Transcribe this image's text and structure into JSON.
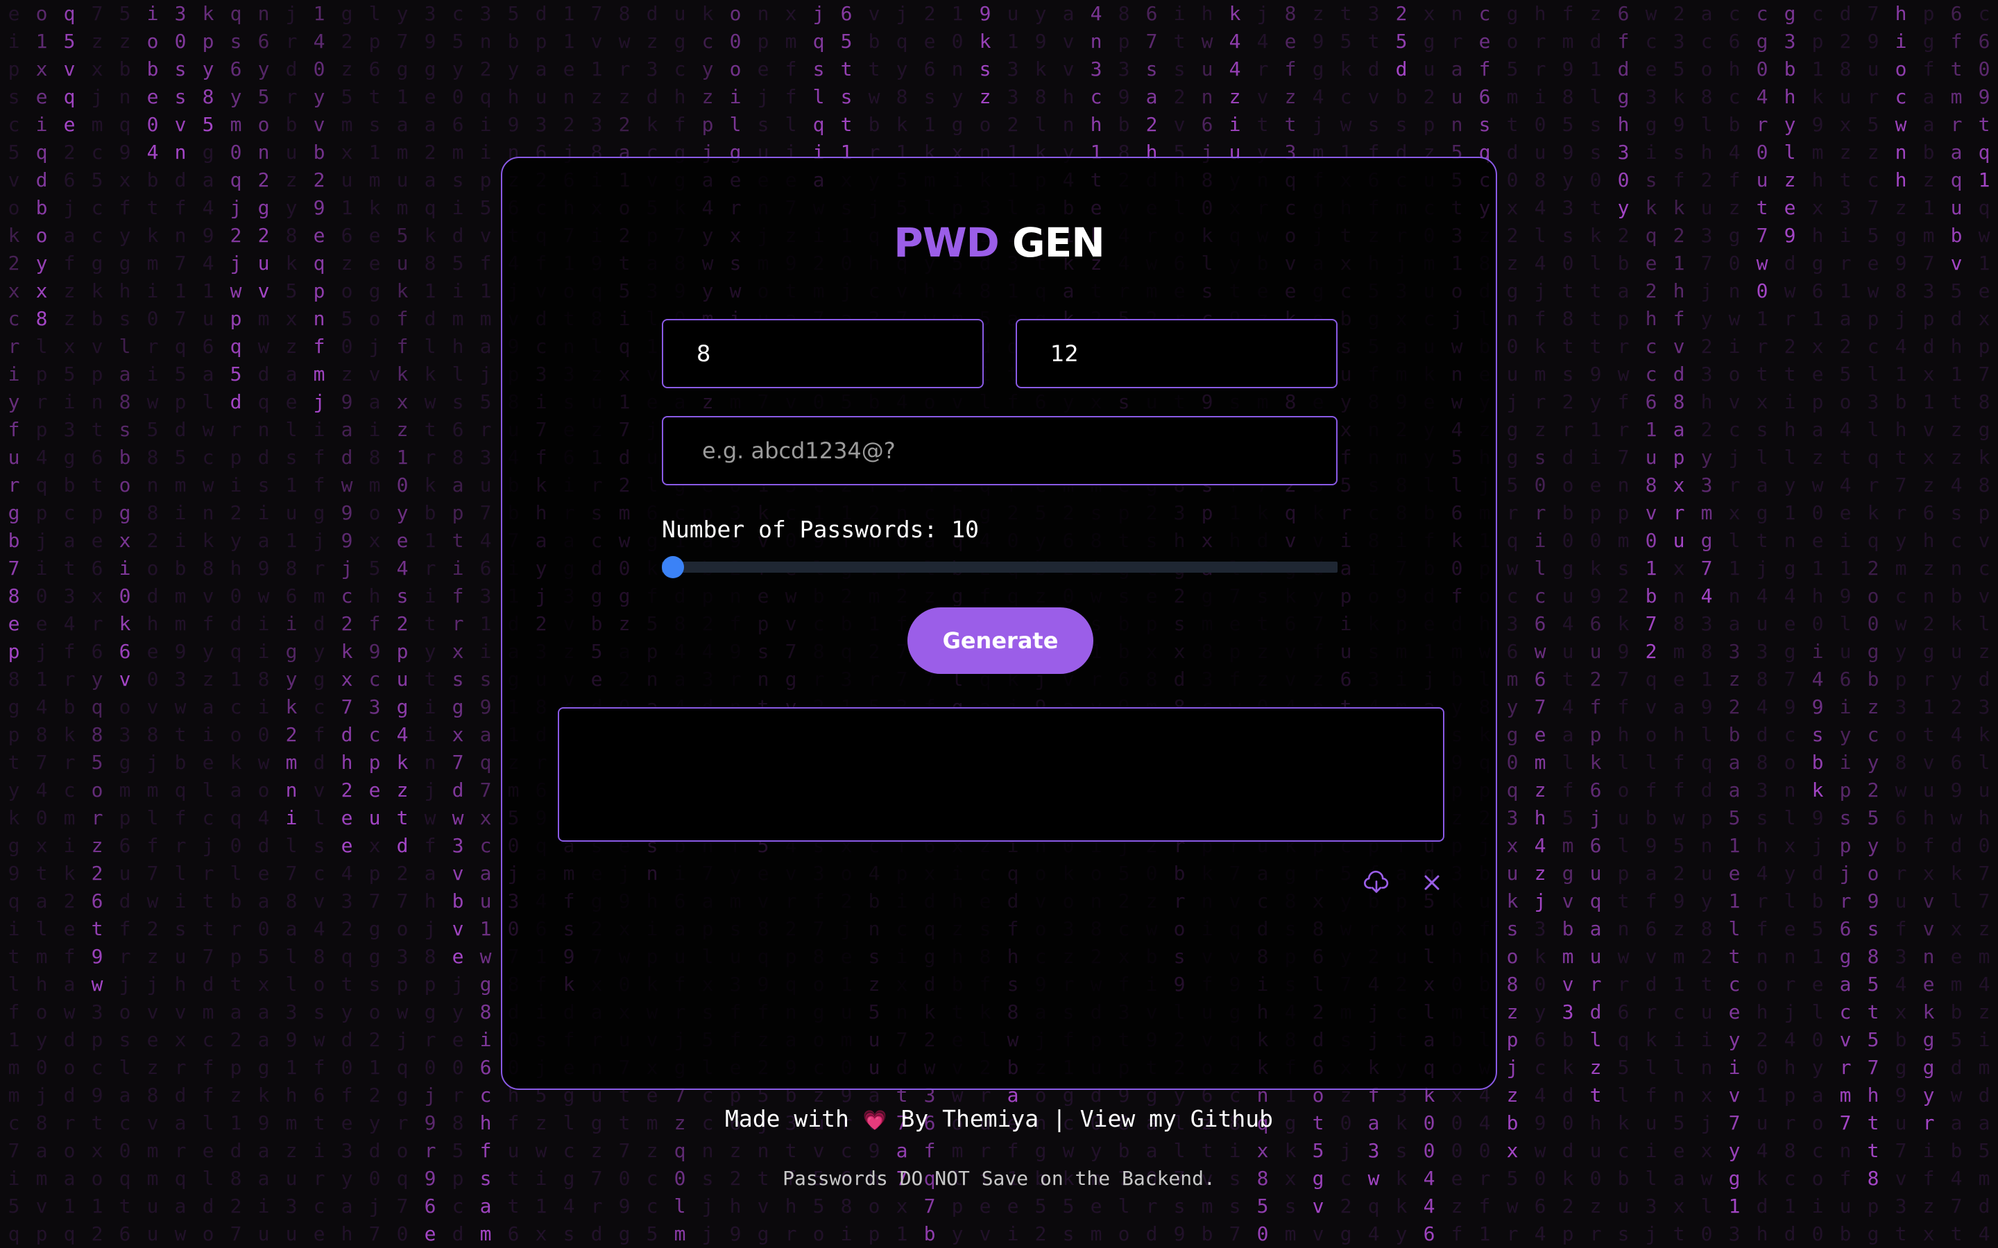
{
  "app": {
    "title_accent": "PWD",
    "title_main": "GEN"
  },
  "form": {
    "min_length": {
      "value": "8"
    },
    "max_length": {
      "value": "12"
    },
    "charset": {
      "value": "",
      "placeholder": "e.g. abcd1234@?"
    },
    "count_label": "Number of Passwords: 10",
    "count_value": 10,
    "count_range": [
      10,
      100
    ],
    "generate_label": "Generate"
  },
  "output": {
    "value": ""
  },
  "actions": {
    "download_icon": "cloud-download-icon",
    "clear_icon": "close-icon"
  },
  "footer": {
    "made_with": "Made with",
    "heart": "💗",
    "by_author": "By Themiya",
    "separator": "|",
    "github_link": "View my Github",
    "note": "Passwords DO NOT Save on the Backend."
  },
  "colors": {
    "accent": "#9b5ee8",
    "slider_thumb": "#3b82f6",
    "background": "#0b090c"
  }
}
